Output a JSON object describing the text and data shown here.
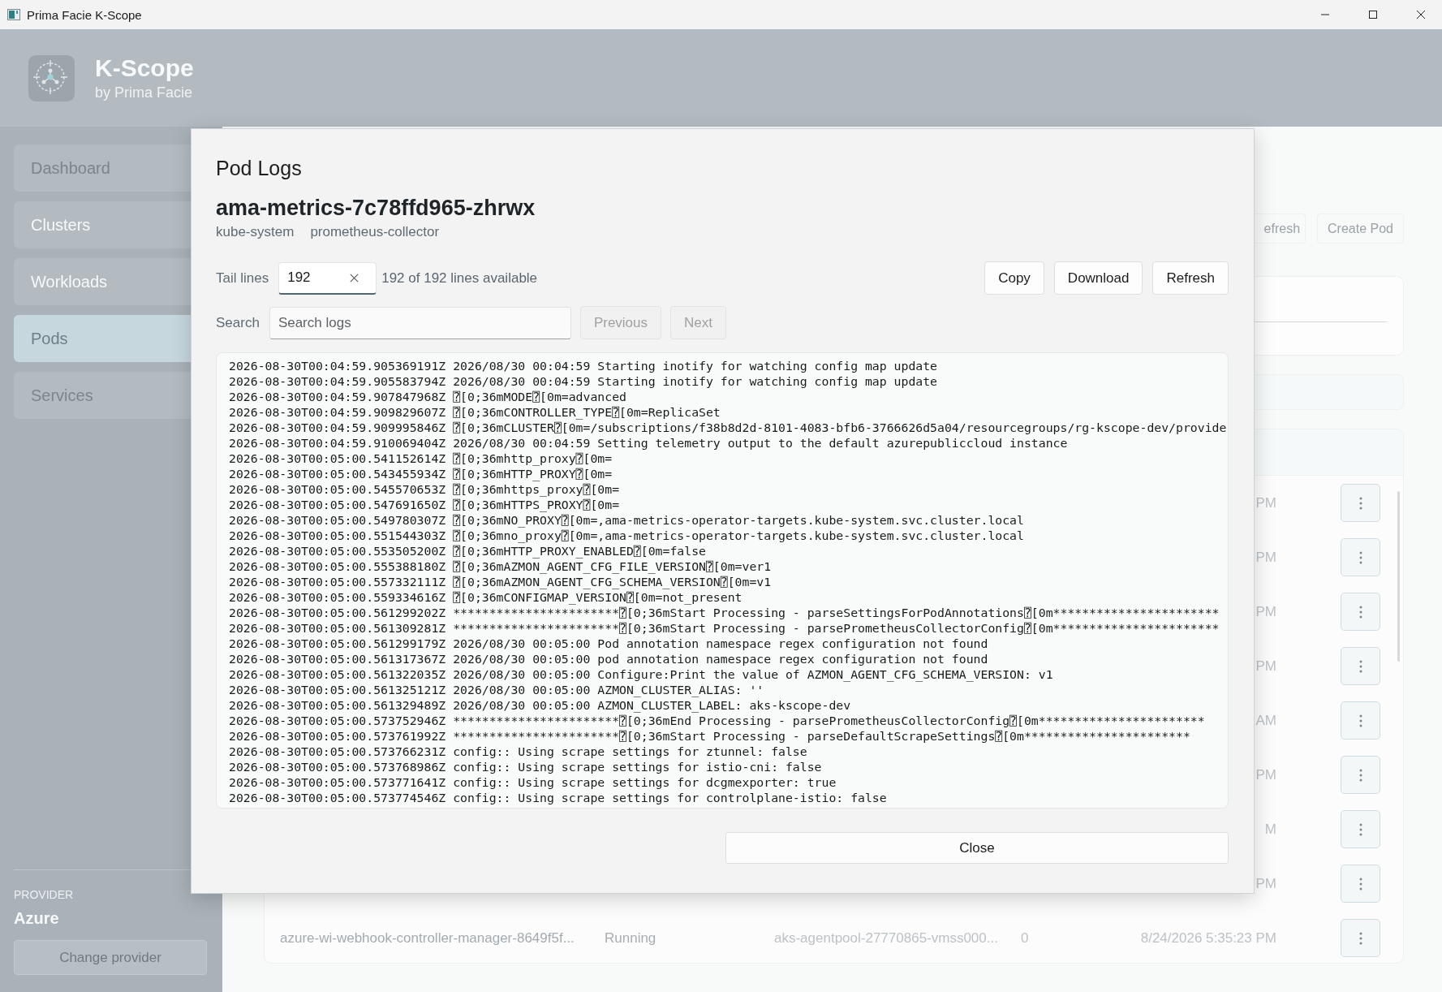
{
  "window": {
    "title": "Prima Facie K-Scope"
  },
  "header": {
    "app_name": "K-Scope",
    "subtitle": "by Prima Facie"
  },
  "sidebar": {
    "items": [
      {
        "label": "Dashboard",
        "selected": false,
        "disabled": true
      },
      {
        "label": "Clusters",
        "selected": false,
        "disabled": false
      },
      {
        "label": "Workloads",
        "selected": false,
        "disabled": false
      },
      {
        "label": "Pods",
        "selected": true,
        "disabled": false
      },
      {
        "label": "Services",
        "selected": false,
        "disabled": true
      }
    ],
    "provider_label": "PROVIDER",
    "provider": "Azure",
    "change_button": "Change provider"
  },
  "toolbar": {
    "buttons": [
      "efresh",
      "Create Pod"
    ]
  },
  "pods_table": {
    "rows": [
      {
        "created": "PM"
      },
      {
        "created": "PM"
      },
      {
        "created": "PM"
      },
      {
        "created": "PM"
      },
      {
        "created": "AM"
      },
      {
        "created": "PM"
      },
      {
        "created": "M"
      },
      {
        "created": "PM"
      },
      {
        "name": "azure-wi-webhook-controller-manager-8649f5f...",
        "status": "Running",
        "node": "aks-agentpool-27770865-vmss000...",
        "restarts": "0",
        "created": "8/24/2026 5:35:23 PM"
      }
    ]
  },
  "dialog": {
    "title": "Pod Logs",
    "pod_name": "ama-metrics-7c78ffd965-zhrwx",
    "tags": [
      "kube-system",
      "prometheus-collector"
    ],
    "tail_label": "Tail lines",
    "tail_value": "192",
    "lines_available": "192 of 192 lines available",
    "actions": [
      "Copy",
      "Download",
      "Refresh"
    ],
    "search_label": "Search",
    "search": {
      "placeholder": "Search logs"
    },
    "nav": [
      {
        "label": "Previous",
        "disabled": true
      },
      {
        "label": "Next",
        "disabled": true
      }
    ],
    "log_lines": [
      "2026-08-30T00:04:59.905369191Z 2026/08/30 00:04:59 Starting inotify for watching config map update",
      "2026-08-30T00:04:59.905583794Z 2026/08/30 00:04:59 Starting inotify for watching config map update",
      "2026-08-30T00:04:59.907847968Z ⍰[0;36mMODE⍰[0m=advanced",
      "2026-08-30T00:04:59.909829607Z ⍰[0;36mCONTROLLER_TYPE⍰[0m=ReplicaSet",
      "2026-08-30T00:04:59.909995846Z ⍰[0;36mCLUSTER⍰[0m=/subscriptions/f38b8d2d-8101-4083-bfb6-3766626d5a04/resourcegroups/rg-kscope-dev/provide",
      "2026-08-30T00:04:59.910069404Z 2026/08/30 00:04:59 Setting telemetry output to the default azurepubliccloud instance",
      "2026-08-30T00:05:00.541152614Z ⍰[0;36mhttp_proxy⍰[0m=",
      "2026-08-30T00:05:00.543455934Z ⍰[0;36mHTTP_PROXY⍰[0m=",
      "2026-08-30T00:05:00.545570653Z ⍰[0;36mhttps_proxy⍰[0m=",
      "2026-08-30T00:05:00.547691650Z ⍰[0;36mHTTPS_PROXY⍰[0m=",
      "2026-08-30T00:05:00.549780307Z ⍰[0;36mNO_PROXY⍰[0m=,ama-metrics-operator-targets.kube-system.svc.cluster.local",
      "2026-08-30T00:05:00.551544303Z ⍰[0;36mno_proxy⍰[0m=,ama-metrics-operator-targets.kube-system.svc.cluster.local",
      "2026-08-30T00:05:00.553505200Z ⍰[0;36mHTTP_PROXY_ENABLED⍰[0m=false",
      "2026-08-30T00:05:00.555388180Z ⍰[0;36mAZMON_AGENT_CFG_FILE_VERSION⍰[0m=ver1",
      "2026-08-30T00:05:00.557332111Z ⍰[0;36mAZMON_AGENT_CFG_SCHEMA_VERSION⍰[0m=v1",
      "2026-08-30T00:05:00.559334616Z ⍰[0;36mCONFIGMAP_VERSION⍰[0m=not_present",
      "2026-08-30T00:05:00.561299202Z ***********************⍰[0;36mStart Processing - parseSettingsForPodAnnotations⍰[0m***********************",
      "2026-08-30T00:05:00.561309281Z ***********************⍰[0;36mStart Processing - parsePrometheusCollectorConfig⍰[0m***********************",
      "2026-08-30T00:05:00.561299179Z 2026/08/30 00:05:00 Pod annotation namespace regex configuration not found",
      "2026-08-30T00:05:00.561317367Z 2026/08/30 00:05:00 pod annotation namespace regex configuration not found",
      "2026-08-30T00:05:00.561322035Z 2026/08/30 00:05:00 Configure:Print the value of AZMON_AGENT_CFG_SCHEMA_VERSION: v1",
      "2026-08-30T00:05:00.561325121Z 2026/08/30 00:05:00 AZMON_CLUSTER_ALIAS: ''",
      "2026-08-30T00:05:00.561329489Z 2026/08/30 00:05:00 AZMON_CLUSTER_LABEL: aks-kscope-dev",
      "2026-08-30T00:05:00.573752946Z ***********************⍰[0;36mEnd Processing - parsePrometheusCollectorConfig⍰[0m***********************",
      "2026-08-30T00:05:00.573761992Z ***********************⍰[0;36mStart Processing - parseDefaultScrapeSettings⍰[0m***********************",
      "2026-08-30T00:05:00.573766231Z config:: Using scrape settings for ztunnel: false",
      "2026-08-30T00:05:00.573768986Z config:: Using scrape settings for istio-cni: false",
      "2026-08-30T00:05:00.573771641Z config:: Using scrape settings for dcgmexporter: true",
      "2026-08-30T00:05:00.573774546Z config:: Using scrape settings for controlplane-istio: false"
    ],
    "close_button": "Close"
  }
}
